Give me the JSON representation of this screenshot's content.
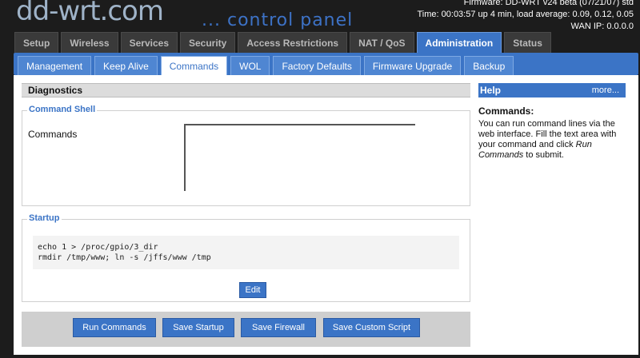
{
  "header": {
    "logo_text": "dd-wrt.com",
    "subtitle": "... control panel",
    "firmware": "Firmware: DD-WRT v24 beta (07/21/07) std",
    "time": "Time: 00:03:57 up 4 min, load average: 0.09, 0.12, 0.05",
    "wan_ip": "WAN IP: 0.0.0.0"
  },
  "main_tabs": [
    {
      "label": "Setup"
    },
    {
      "label": "Wireless"
    },
    {
      "label": "Services"
    },
    {
      "label": "Security"
    },
    {
      "label": "Access Restrictions"
    },
    {
      "label": "NAT / QoS"
    },
    {
      "label": "Administration"
    },
    {
      "label": "Status"
    }
  ],
  "sub_tabs": [
    {
      "label": "Management"
    },
    {
      "label": "Keep Alive"
    },
    {
      "label": "Commands"
    },
    {
      "label": "WOL"
    },
    {
      "label": "Factory Defaults"
    },
    {
      "label": "Firmware Upgrade"
    },
    {
      "label": "Backup"
    }
  ],
  "diagnostics": {
    "title": "Diagnostics",
    "command_shell": {
      "legend": "Command Shell",
      "label": "Commands",
      "value": ""
    },
    "startup": {
      "legend": "Startup",
      "script": "echo 1 > /proc/gpio/3_dir\nrmdir /tmp/www; ln -s /jffs/www /tmp",
      "edit_label": "Edit"
    }
  },
  "actions": {
    "run_commands": "Run Commands",
    "save_startup": "Save Startup",
    "save_firewall": "Save Firewall",
    "save_custom_script": "Save Custom Script"
  },
  "help": {
    "title": "Help",
    "more": "more...",
    "section_title": "Commands:",
    "text_before": "You can run command lines via the web interface. Fill the text area with your command and click ",
    "text_em": "Run Commands",
    "text_after": " to submit."
  }
}
